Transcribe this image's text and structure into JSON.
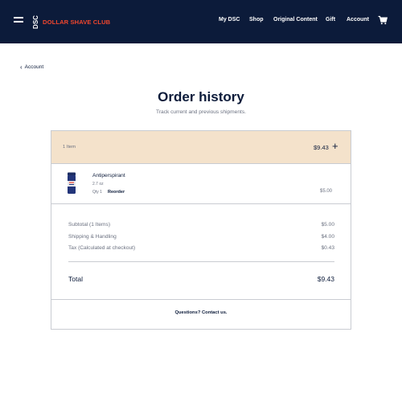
{
  "header": {
    "logo_mark": "DSC",
    "logo_text": "DOLLAR SHAVE CLUB",
    "nav": [
      "My DSC",
      "Shop",
      "Original Content",
      "Gift",
      "Account"
    ]
  },
  "back_link": "Account",
  "page": {
    "title": "Order history",
    "subtitle": "Track current and previous shipments."
  },
  "order": {
    "item_count": "1 Item",
    "total": "$9.43",
    "items": [
      {
        "name": "Antiperspirant",
        "size": "2.7 oz",
        "qty": "Qty 1",
        "action": "Reorder",
        "price": "$5.00"
      }
    ],
    "summary": [
      {
        "label": "Subtotal (1 Items)",
        "value": "$5.00"
      },
      {
        "label": "Shipping & Handling",
        "value": "$4.00"
      },
      {
        "label": "Tax (Calculated at checkout)",
        "value": "$0.43"
      }
    ],
    "total_label": "Total",
    "total_value": "$9.43",
    "help": "Questions? Contact us."
  },
  "colors": {
    "nav_bg": "#0c1b3a",
    "brand_red": "#f0462d",
    "order_header_bg": "#f4e2cb"
  }
}
